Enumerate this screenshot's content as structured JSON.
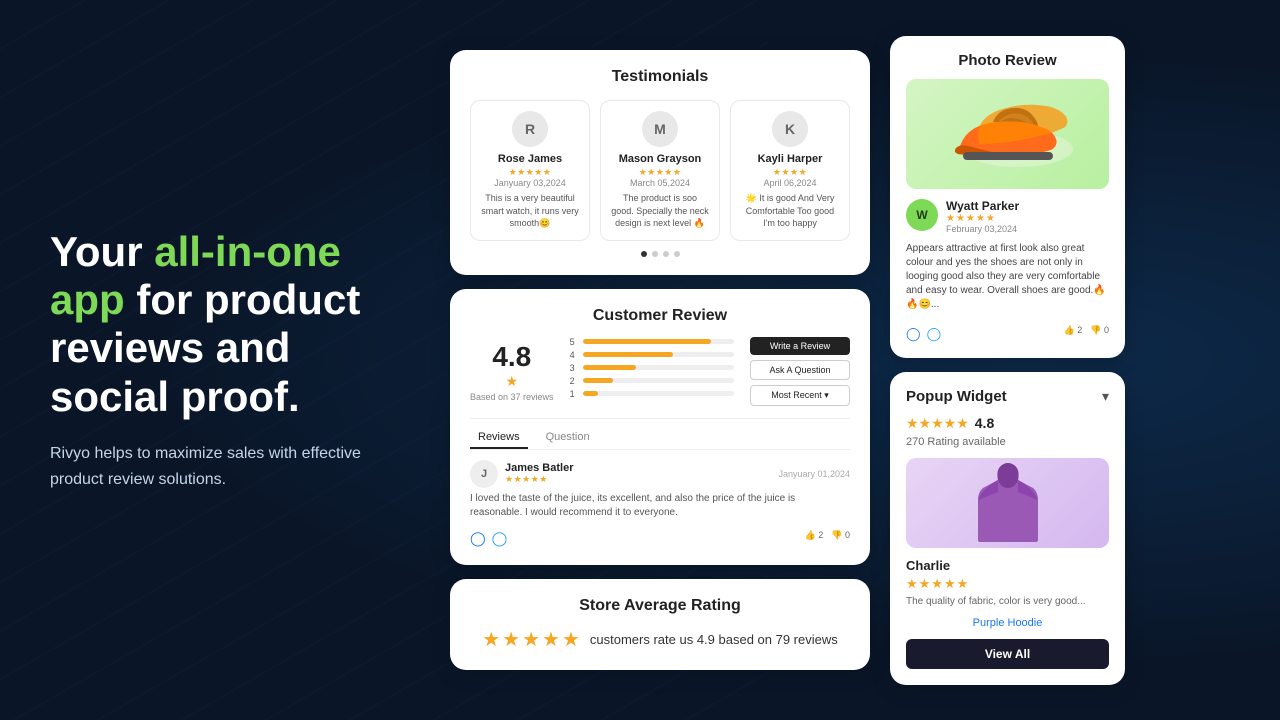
{
  "hero": {
    "title_plain": "Your ",
    "title_highlight": "all-in-one app",
    "title_rest": " for product reviews and social proof.",
    "subtitle": "Rivyo helps to maximize sales with effective product review solutions."
  },
  "testimonials": {
    "title": "Testimonials",
    "reviews": [
      {
        "initial": "R",
        "name": "Rose James",
        "date": "Janyuary 03,2024",
        "stars": "★★★★★",
        "text": "This is a very beautiful smart watch, it runs very smooth😊"
      },
      {
        "initial": "M",
        "name": "Mason Grayson",
        "date": "March 05,2024",
        "stars": "★★★★★",
        "text": "The product is soo good. Specially the neck design is next level 🔥"
      },
      {
        "initial": "K",
        "name": "Kayli Harper",
        "date": "April 06,2024",
        "stars": "★★★★",
        "text": "🌟 It is good And Very Comfortable Too good I'm too happy"
      }
    ],
    "dots": [
      true,
      false,
      false,
      false
    ]
  },
  "customer_review": {
    "title": "Customer Review",
    "rating": "4.8",
    "rating_star": "★",
    "based_on": "Based on 37 reviews",
    "bars": [
      {
        "label": "5",
        "fill": 85
      },
      {
        "label": "4",
        "fill": 60
      },
      {
        "label": "3",
        "fill": 35
      },
      {
        "label": "2",
        "fill": 20
      },
      {
        "label": "1",
        "fill": 10
      }
    ],
    "buttons": {
      "write": "Write a Review",
      "ask": "Ask A Question",
      "sort": "Most Recent ▾"
    },
    "tabs": [
      "Reviews",
      "Question"
    ],
    "review_entry": {
      "initial": "J",
      "name": "James Batler",
      "date": "Janyuary 01,2024",
      "stars": "★★★★★",
      "text": "I loved the taste of the juice, its excellent, and also the price of the juice is reasonable. I would recommend it to everyone.",
      "likes": "2",
      "dislikes": "0"
    }
  },
  "store_avg": {
    "title": "Store Average Rating",
    "stars": "★★★★★",
    "text": "customers rate us 4.9 based on 79 reviews"
  },
  "photo_review": {
    "title": "Photo Review",
    "reviewer": {
      "initial": "W",
      "name": "Wyatt Parker",
      "date": "February 03,2024",
      "stars": "★★★★★",
      "text": "Appears attractive at first look also great colour and yes the shoes are not only in looging good also they are very comfortable and easy to wear. Overall shoes are good.🔥🔥😊..."
    },
    "likes": "2",
    "dislikes": "0"
  },
  "popup_widget": {
    "title": "Popup Widget",
    "rating": "4.8",
    "stars": "★★★★★",
    "count": "270 Rating available",
    "reviewer": {
      "name": "Charlie",
      "stars": "★★★★★",
      "text": "The quality of fabric, color is very good..."
    },
    "product_link": "Purple Hoodie",
    "view_all_btn": "View All"
  }
}
